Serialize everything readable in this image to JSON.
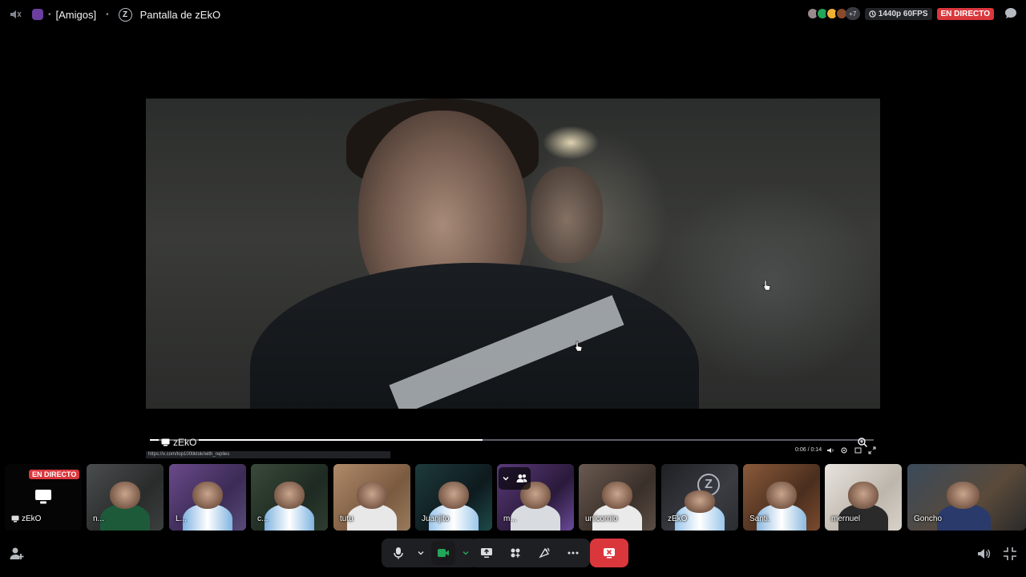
{
  "topbar": {
    "breadcrumb_server": "[Amigos]",
    "channel_title": "Pantalla de zEkO",
    "viewer_more": "+7",
    "quality": "1440p 60FPS",
    "live_label": "EN DIRECTO",
    "icons": [
      "speaker-muted-icon",
      "server-icon",
      "zeko-logo-icon",
      "chat-icon"
    ]
  },
  "stream": {
    "streamer_name": "zEkO",
    "url": "https://x.com/top100tiktok/with_replies",
    "time": "0:06 / 0:14",
    "progress": 0.46
  },
  "tiles": [
    {
      "name": "zEkO",
      "type": "stream",
      "badge": "EN DIRECTO"
    },
    {
      "name": "n...",
      "speaking": false
    },
    {
      "name": "L...",
      "speaking": true
    },
    {
      "name": "c...",
      "speaking": true
    },
    {
      "name": "tutu",
      "speaking": true
    },
    {
      "name": "Juanjito",
      "speaking": false
    },
    {
      "name": "m...",
      "speaking": false
    },
    {
      "name": "unicornio",
      "speaking": false
    },
    {
      "name": "zEkO",
      "speaking": false
    },
    {
      "name": "Santi.",
      "speaking": false
    },
    {
      "name": "mernuel",
      "speaking": false
    },
    {
      "name": "Goncho",
      "speaking": false
    }
  ],
  "colors": {
    "live": "#da373c",
    "speaking": "#23a55a",
    "control_bg": "#1e1f22",
    "background": "#000000"
  }
}
